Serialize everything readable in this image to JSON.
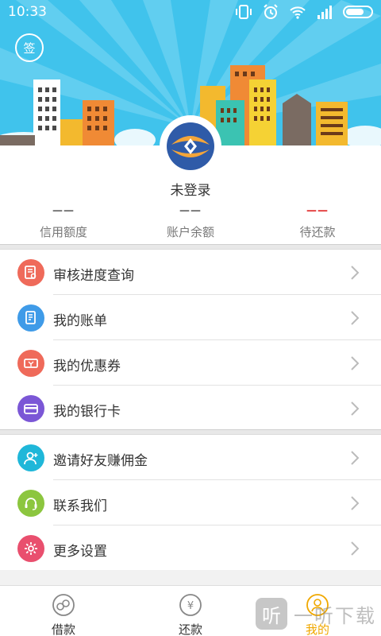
{
  "status_bar": {
    "time": "10:33"
  },
  "header": {
    "sign_in_label": "签"
  },
  "profile": {
    "login_status": "未登录"
  },
  "stats": [
    {
      "value": "——",
      "label": "信用额度"
    },
    {
      "value": "——",
      "label": "账户余额"
    },
    {
      "value": "——",
      "label": "待还款"
    }
  ],
  "menu_group_1": [
    {
      "label": "审核进度查询",
      "icon": "document-search-icon",
      "color": "#ef6a5a"
    },
    {
      "label": "我的账单",
      "icon": "bill-icon",
      "color": "#3f9be8"
    },
    {
      "label": "我的优惠券",
      "icon": "coupon-icon",
      "color": "#ef6a5a"
    },
    {
      "label": "我的银行卡",
      "icon": "bank-card-icon",
      "color": "#7b57d6"
    }
  ],
  "menu_group_2": [
    {
      "label": "邀请好友赚佣金",
      "icon": "invite-friend-icon",
      "color": "#1fb7d9"
    },
    {
      "label": "联系我们",
      "icon": "headset-icon",
      "color": "#8cc63f"
    },
    {
      "label": "更多设置",
      "icon": "settings-icon",
      "color": "#e94f6e"
    }
  ],
  "tabs": [
    {
      "label": "借款",
      "icon": "borrow-icon"
    },
    {
      "label": "还款",
      "icon": "repay-icon"
    },
    {
      "label": "我的",
      "icon": "profile-icon"
    }
  ],
  "watermark": {
    "logo": "听",
    "text": "一听下载"
  },
  "colors": {
    "banner": "#40c3ec",
    "active_tab": "#f0a800",
    "pending_red": "#e02b2b"
  }
}
